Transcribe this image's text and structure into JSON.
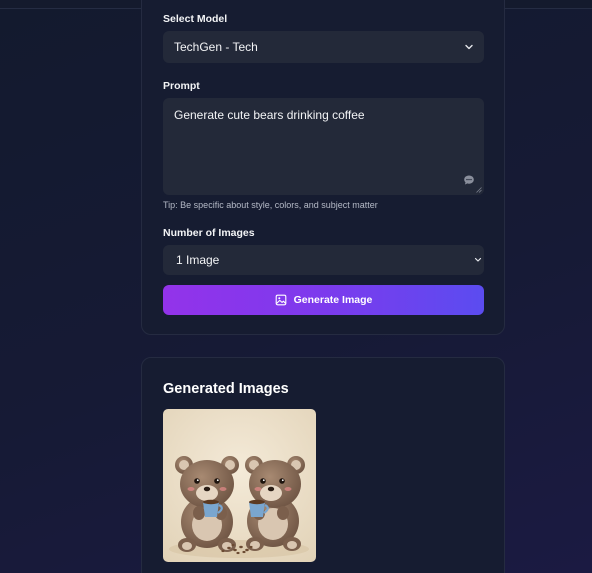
{
  "form": {
    "model_label": "Select Model",
    "model_value": "TechGen - Tech",
    "prompt_label": "Prompt",
    "prompt_value": "Generate cute bears drinking coffee",
    "tip": "Tip: Be specific about style, colors, and subject matter",
    "count_label": "Number of Images",
    "count_value": "1 Image",
    "generate_label": "Generate Image"
  },
  "results": {
    "title": "Generated Images"
  },
  "colors": {
    "button_start": "#9333ea",
    "button_end": "#5b4cf0",
    "card_bg": "#161c31",
    "field_bg": "#232939"
  },
  "icons": {
    "model_select": "chevron-down-icon",
    "prompt_hint": "chat-bubble-icon",
    "count_select": "chevron-down-icon",
    "generate": "image-icon"
  }
}
